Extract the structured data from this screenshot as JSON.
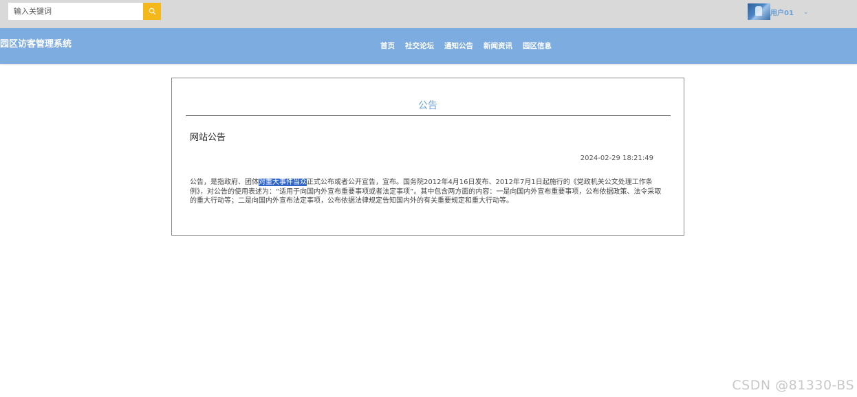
{
  "topbar": {
    "search_placeholder": "输入关键词",
    "username": "用户01",
    "user_menu_caret": "⌄"
  },
  "navbar": {
    "brand": "园区访客管理系统",
    "links": [
      "首页",
      "社交论坛",
      "通知公告",
      "新闻资讯",
      "园区信息"
    ]
  },
  "notice": {
    "section_heading": "公告",
    "title": "网站公告",
    "timestamp": "2024-02-29 18:21:49",
    "body_before": "公告，是指政府、团体",
    "body_selected": "对重大事件当众",
    "body_after": "正式公布或者公开宣告，宣布。国务院2012年4月16日发布、2012年7月1日起施行的《党政机关公文处理工作条例》，对公告的使用表述为：“适用于向国内外宣布重要事项或者法定事项”。其中包含两方面的内容：一是向国内外宣布重要事项，公布依据政策、法令采取的重大行动等；二是向国内外宣布法定事项，公布依据法律规定告知国内外的有关重要规定和重大行动等。"
  },
  "watermark": "CSDN @81330-BS",
  "colors": {
    "topbar_bg": "#d9d9d9",
    "navbar_bg": "#7dace0",
    "search_button": "#f5b81a",
    "accent": "#6aa0d6",
    "selection": "#2f64c8"
  },
  "icons": {
    "search_button": "search-icon",
    "user_menu": "chevron-down-icon"
  }
}
